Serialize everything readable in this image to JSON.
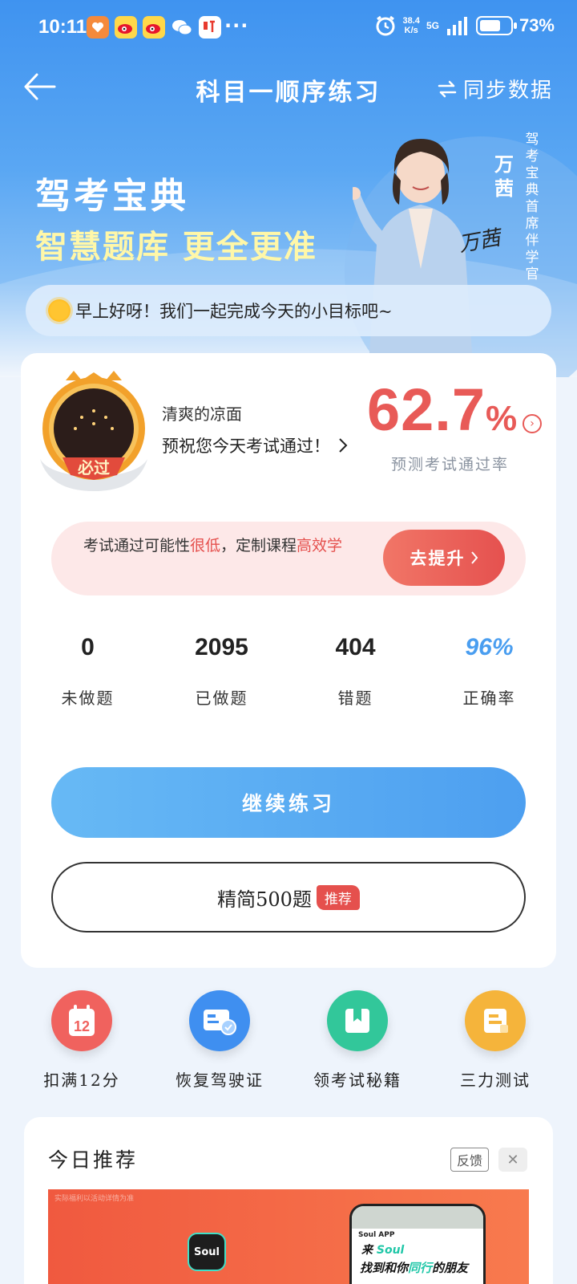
{
  "status_bar": {
    "time": "10:11",
    "more": "···",
    "speed_value": "38.4",
    "speed_unit": "K/s",
    "network": "5G",
    "battery": "73%"
  },
  "nav": {
    "title": "科目一顺序练习",
    "sync_label": "同步数据"
  },
  "banner": {
    "brand": "驾考宝典",
    "slogan": "智慧题库 更全更准",
    "spokesperson": "万茜",
    "role": "驾考宝典首席伴学官",
    "signature": "万茜"
  },
  "greeting": "早上好呀！我们一起完成今天的小目标吧~",
  "user": {
    "badge_text": "必过",
    "nickname": "清爽的凉面",
    "wish": "预祝您今天考试通过！"
  },
  "pass_rate": {
    "value": "62.7",
    "unit": "%",
    "label": "预测考试通过率"
  },
  "tip": {
    "prefix": "考试通过可能性",
    "level": "很低",
    "middle": "，定制课程",
    "highlight": "高效学",
    "button": "去提升"
  },
  "stats": [
    {
      "value": "0",
      "label": "未做题"
    },
    {
      "value": "2095",
      "label": "已做题"
    },
    {
      "value": "404",
      "label": "错题"
    },
    {
      "value": "96%",
      "label": "正确率"
    }
  ],
  "buttons": {
    "continue": "继续练习",
    "refined": "精简500题",
    "refined_tag": "推荐"
  },
  "quick_entries": [
    {
      "label": "扣满12分",
      "icon": "calendar-12-icon",
      "icon_text": "12",
      "color": "#f0625e"
    },
    {
      "label": "恢复驾驶证",
      "icon": "license-check-icon",
      "color": "#3f8ff0"
    },
    {
      "label": "领考试秘籍",
      "icon": "book-icon",
      "color": "#32c79a"
    },
    {
      "label": "三力测试",
      "icon": "document-icon",
      "color": "#f5b43b"
    }
  ],
  "recommend": {
    "title": "今日推荐",
    "feedback": "反馈",
    "close": "✕",
    "ad": {
      "small_text": "实际福利以活动详情为准",
      "logo": "Soul",
      "app_tag": "Soul APP",
      "line1_a": "来",
      "line1_b": "Soul",
      "line2_a": "找到和你",
      "line2_b": "同行",
      "line2_c": "的朋友"
    }
  }
}
